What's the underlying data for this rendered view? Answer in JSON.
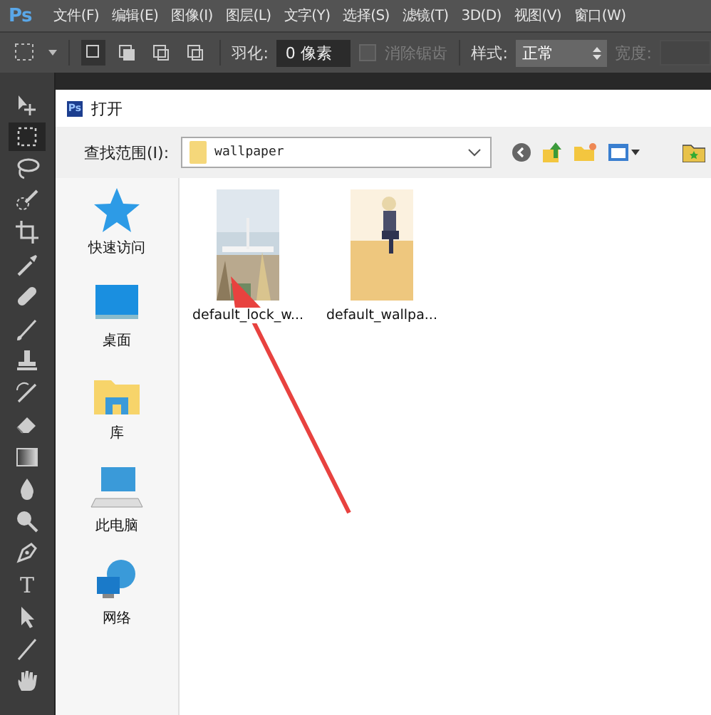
{
  "app_logo": "Ps",
  "menu": [
    "文件(F)",
    "编辑(E)",
    "图像(I)",
    "图层(L)",
    "文字(Y)",
    "选择(S)",
    "滤镜(T)",
    "3D(D)",
    "视图(V)",
    "窗口(W)"
  ],
  "options_bar": {
    "modes": [
      {
        "selected": true
      },
      {
        "selected": false
      },
      {
        "selected": false
      },
      {
        "selected": false
      }
    ],
    "feather": {
      "label": "羽化:",
      "value": "0 像素"
    },
    "antialias": {
      "label": "消除锯齿",
      "checked": false,
      "disabled": true
    },
    "style": {
      "label": "样式:",
      "value": "正常"
    },
    "width": {
      "label": "宽度:",
      "disabled": true
    }
  },
  "tools": [
    {
      "kind": "move",
      "selected": false
    },
    {
      "kind": "marquee",
      "selected": true
    },
    {
      "kind": "lasso",
      "selected": false
    },
    {
      "kind": "quick",
      "selected": false
    },
    {
      "kind": "crop",
      "selected": false
    },
    {
      "kind": "eyedropper",
      "selected": false
    },
    {
      "kind": "heal",
      "selected": false
    },
    {
      "kind": "brush",
      "selected": false
    },
    {
      "kind": "stamp",
      "selected": false
    },
    {
      "kind": "history",
      "selected": false
    },
    {
      "kind": "eraser",
      "selected": false
    },
    {
      "kind": "gradient",
      "selected": false
    },
    {
      "kind": "blur",
      "selected": false
    },
    {
      "kind": "dodge",
      "selected": false
    },
    {
      "kind": "pen",
      "selected": false
    },
    {
      "kind": "type",
      "selected": false,
      "label": "T"
    },
    {
      "kind": "path",
      "selected": false
    },
    {
      "kind": "line",
      "selected": false
    },
    {
      "kind": "hand",
      "selected": false
    }
  ],
  "dialog": {
    "icon": "Ps",
    "title": "打开",
    "look_in": {
      "label": "查找范围(I):",
      "value": "wallpaper"
    },
    "places": [
      {
        "kind": "quick",
        "label": "快速访问"
      },
      {
        "kind": "desktop",
        "label": "桌面"
      },
      {
        "kind": "library",
        "label": "库"
      },
      {
        "kind": "pc",
        "label": "此电脑"
      },
      {
        "kind": "network",
        "label": "网络"
      }
    ],
    "files": [
      {
        "kind": "picture",
        "name": "default_lock_w..."
      },
      {
        "kind": "picture",
        "name": "default_wallpa..."
      }
    ]
  }
}
